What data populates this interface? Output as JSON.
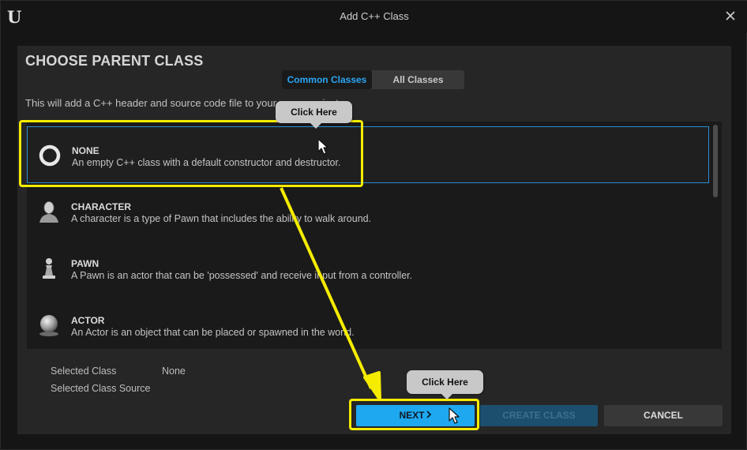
{
  "window": {
    "title": "Add C++ Class"
  },
  "panel": {
    "heading": "CHOOSE PARENT CLASS",
    "tabs": [
      {
        "label": "Common Classes",
        "active": true
      },
      {
        "label": "All Classes",
        "active": false
      }
    ],
    "description": "This will add a C++ header and source code file to your game project."
  },
  "classes": [
    {
      "name": "NONE",
      "description": "An empty C++ class with a default constructor and destructor.",
      "icon": "ring-icon",
      "selected": true
    },
    {
      "name": "CHARACTER",
      "description": "A character is a type of Pawn that includes the ability to walk around.",
      "icon": "character-icon",
      "selected": false
    },
    {
      "name": "PAWN",
      "description": "A Pawn is an actor that can be 'possessed' and receive input from a controller.",
      "icon": "pawn-icon",
      "selected": false
    },
    {
      "name": "ACTOR",
      "description": "An Actor is an object that can be placed or spawned in the world.",
      "icon": "sphere-icon",
      "selected": false
    }
  ],
  "info": {
    "selected_class_label": "Selected Class",
    "selected_class_value": "None",
    "selected_class_source_label": "Selected Class Source"
  },
  "buttons": {
    "next_label": "NEXT",
    "create_label": "CREATE CLASS",
    "cancel_label": "CANCEL"
  },
  "annotations": {
    "tooltip_top": "Click Here",
    "tooltip_bottom": "Click Here",
    "highlight_color": "#f5ec00"
  },
  "colors": {
    "accent": "#1ea8f0",
    "selection_border": "#2a8fd2",
    "background": "#151515",
    "panel": "#262626"
  }
}
